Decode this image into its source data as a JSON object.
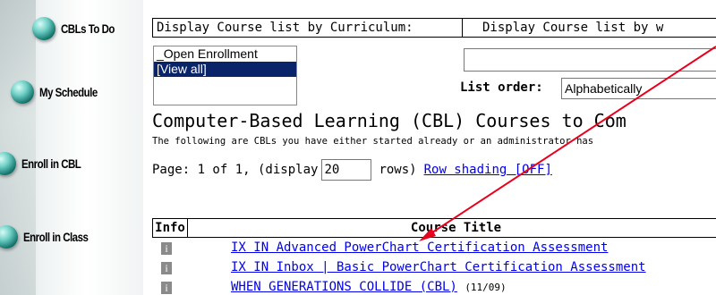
{
  "sidebar": {
    "items": [
      {
        "label": "CBLs To Do"
      },
      {
        "label": "My Schedule"
      },
      {
        "label": "Enroll in CBL"
      },
      {
        "label": "Enroll in Class"
      }
    ]
  },
  "filters": {
    "curriculum_header": "Display Course list by Curriculum:",
    "other_header": "Display Course list by w",
    "curriculum_options": [
      {
        "label": "_Open Enrollment",
        "selected": false
      },
      {
        "label": "[View all]",
        "selected": true
      }
    ],
    "list_order_label": "List order:",
    "list_order_value": "Alphabetically"
  },
  "main": {
    "title": "Computer-Based Learning (CBL) Courses to Com",
    "subtitle": "The following are CBLs you have either started already or an administrator has",
    "pager_prefix": "Page: 1 of 1, (display",
    "rows_value": "20",
    "pager_suffix": "rows)",
    "row_shading_link": "Row shading [OFF]"
  },
  "table": {
    "headers": {
      "info": "Info",
      "title": "Course Title"
    },
    "rows": [
      {
        "title": "IX IN Advanced PowerChart Certification Assessment",
        "note": ""
      },
      {
        "title": "IX IN Inbox | Basic PowerChart Certification Assessment",
        "note": ""
      },
      {
        "title": "WHEN GENERATIONS COLLIDE (CBL)",
        "note": "(11/09)"
      }
    ]
  },
  "colors": {
    "link": "#0000ee",
    "selection": "#0a246a",
    "annotation_arrow": "#e8001c",
    "nav_ball": "#1a8f86"
  },
  "icons": {
    "info": "info-icon",
    "nav": "sphere-icon"
  }
}
